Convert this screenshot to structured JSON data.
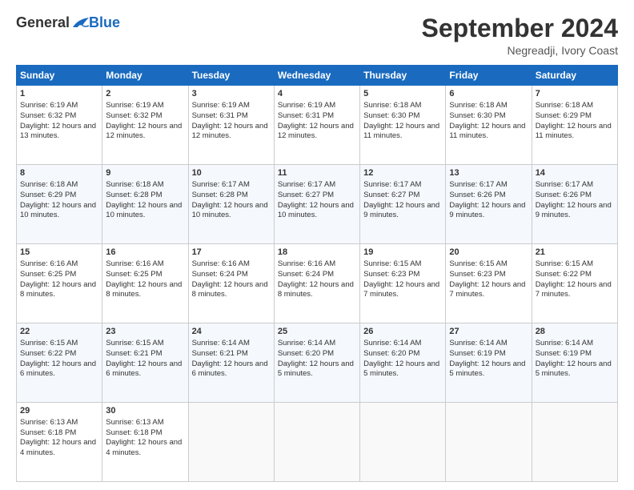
{
  "header": {
    "logo_general": "General",
    "logo_blue": "Blue",
    "month_title": "September 2024",
    "location": "Negreadji, Ivory Coast"
  },
  "days_of_week": [
    "Sunday",
    "Monday",
    "Tuesday",
    "Wednesday",
    "Thursday",
    "Friday",
    "Saturday"
  ],
  "weeks": [
    [
      {
        "day": 1,
        "sunrise": "6:19 AM",
        "sunset": "6:32 PM",
        "daylight": "12 hours and 13 minutes."
      },
      {
        "day": 2,
        "sunrise": "6:19 AM",
        "sunset": "6:32 PM",
        "daylight": "12 hours and 12 minutes."
      },
      {
        "day": 3,
        "sunrise": "6:19 AM",
        "sunset": "6:31 PM",
        "daylight": "12 hours and 12 minutes."
      },
      {
        "day": 4,
        "sunrise": "6:19 AM",
        "sunset": "6:31 PM",
        "daylight": "12 hours and 12 minutes."
      },
      {
        "day": 5,
        "sunrise": "6:18 AM",
        "sunset": "6:30 PM",
        "daylight": "12 hours and 11 minutes."
      },
      {
        "day": 6,
        "sunrise": "6:18 AM",
        "sunset": "6:30 PM",
        "daylight": "12 hours and 11 minutes."
      },
      {
        "day": 7,
        "sunrise": "6:18 AM",
        "sunset": "6:29 PM",
        "daylight": "12 hours and 11 minutes."
      }
    ],
    [
      {
        "day": 8,
        "sunrise": "6:18 AM",
        "sunset": "6:29 PM",
        "daylight": "12 hours and 10 minutes."
      },
      {
        "day": 9,
        "sunrise": "6:18 AM",
        "sunset": "6:28 PM",
        "daylight": "12 hours and 10 minutes."
      },
      {
        "day": 10,
        "sunrise": "6:17 AM",
        "sunset": "6:28 PM",
        "daylight": "12 hours and 10 minutes."
      },
      {
        "day": 11,
        "sunrise": "6:17 AM",
        "sunset": "6:27 PM",
        "daylight": "12 hours and 10 minutes."
      },
      {
        "day": 12,
        "sunrise": "6:17 AM",
        "sunset": "6:27 PM",
        "daylight": "12 hours and 9 minutes."
      },
      {
        "day": 13,
        "sunrise": "6:17 AM",
        "sunset": "6:26 PM",
        "daylight": "12 hours and 9 minutes."
      },
      {
        "day": 14,
        "sunrise": "6:17 AM",
        "sunset": "6:26 PM",
        "daylight": "12 hours and 9 minutes."
      }
    ],
    [
      {
        "day": 15,
        "sunrise": "6:16 AM",
        "sunset": "6:25 PM",
        "daylight": "12 hours and 8 minutes."
      },
      {
        "day": 16,
        "sunrise": "6:16 AM",
        "sunset": "6:25 PM",
        "daylight": "12 hours and 8 minutes."
      },
      {
        "day": 17,
        "sunrise": "6:16 AM",
        "sunset": "6:24 PM",
        "daylight": "12 hours and 8 minutes."
      },
      {
        "day": 18,
        "sunrise": "6:16 AM",
        "sunset": "6:24 PM",
        "daylight": "12 hours and 8 minutes."
      },
      {
        "day": 19,
        "sunrise": "6:15 AM",
        "sunset": "6:23 PM",
        "daylight": "12 hours and 7 minutes."
      },
      {
        "day": 20,
        "sunrise": "6:15 AM",
        "sunset": "6:23 PM",
        "daylight": "12 hours and 7 minutes."
      },
      {
        "day": 21,
        "sunrise": "6:15 AM",
        "sunset": "6:22 PM",
        "daylight": "12 hours and 7 minutes."
      }
    ],
    [
      {
        "day": 22,
        "sunrise": "6:15 AM",
        "sunset": "6:22 PM",
        "daylight": "12 hours and 6 minutes."
      },
      {
        "day": 23,
        "sunrise": "6:15 AM",
        "sunset": "6:21 PM",
        "daylight": "12 hours and 6 minutes."
      },
      {
        "day": 24,
        "sunrise": "6:14 AM",
        "sunset": "6:21 PM",
        "daylight": "12 hours and 6 minutes."
      },
      {
        "day": 25,
        "sunrise": "6:14 AM",
        "sunset": "6:20 PM",
        "daylight": "12 hours and 5 minutes."
      },
      {
        "day": 26,
        "sunrise": "6:14 AM",
        "sunset": "6:20 PM",
        "daylight": "12 hours and 5 minutes."
      },
      {
        "day": 27,
        "sunrise": "6:14 AM",
        "sunset": "6:19 PM",
        "daylight": "12 hours and 5 minutes."
      },
      {
        "day": 28,
        "sunrise": "6:14 AM",
        "sunset": "6:19 PM",
        "daylight": "12 hours and 5 minutes."
      }
    ],
    [
      {
        "day": 29,
        "sunrise": "6:13 AM",
        "sunset": "6:18 PM",
        "daylight": "12 hours and 4 minutes."
      },
      {
        "day": 30,
        "sunrise": "6:13 AM",
        "sunset": "6:18 PM",
        "daylight": "12 hours and 4 minutes."
      },
      null,
      null,
      null,
      null,
      null
    ]
  ]
}
